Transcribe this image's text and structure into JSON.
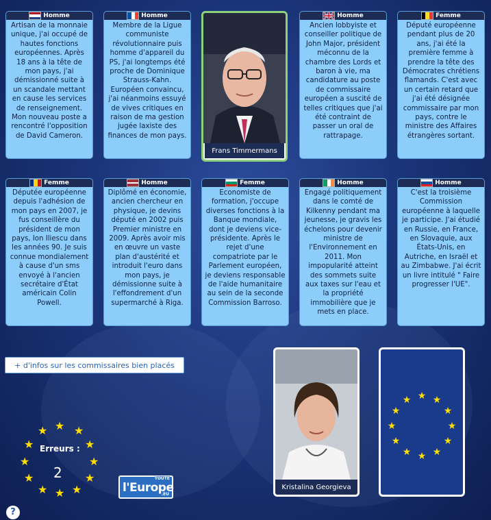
{
  "cards": [
    {
      "gender": "Homme",
      "text": "Artisan de la monnaie unique, j'ai occupé de hautes fonctions européennes. Après 18 ans à la tête de mon pays, j'ai démissionné suite à un scandale mettant en cause les services de renseignement. Mon nouveau poste a rencontré l'opposition de David Cameron."
    },
    {
      "gender": "Homme",
      "text": "Membre de la Ligue communiste révolutionnaire puis homme d'appareil du PS, j'ai longtemps été proche de Dominique Strauss-Kahn. Européen convaincu, j'ai néanmoins essuyé de vives critiques en raison de ma gestion jugée laxiste des finances de mon pays."
    },
    {
      "gender": "Homme",
      "text": "Ancien lobbyiste et conseiller politique de John Major, président méconnu de la chambre des Lords et baron à vie, ma candidature au poste de commissaire européen a suscité de telles critiques que j'ai été contraint de passer un oral de rattrapage."
    },
    {
      "gender": "Femme",
      "text": "Député européenne pendant plus de 20 ans, j'ai été la première femme à prendre la tête des Démocrates chrétiens flamands. C'est avec un certain retard que j'ai été désignée commissaire par mon pays, contre le ministre des Affaires étrangères sortant."
    },
    {
      "gender": "Femme",
      "text": "Députée européenne depuis l'adhésion de mon pays en 2007, je fus conseillère du président de mon pays, Ion Iliescu dans les années 90. Je suis connue mondialement à cause d'un sms envoyé à l'ancien secrétaire d'État américain Colin Powell."
    },
    {
      "gender": "Homme",
      "text": "Diplômé en économie, ancien chercheur en physique, je devins député en 2002 puis Premier ministre en 2009. Après avoir mis en œuvre un vaste plan d'austérité et introduit l'euro dans mon pays, je démissionne suite à l'effondrement d'un supermarché à Riga."
    },
    {
      "gender": "Femme",
      "text": "Economiste de formation, j'occupe diverses fonctions à la Banque mondiale, dont je deviens vice-présidente. Après le rejet d'une compatriote par le Parlement européen, je deviens responsable de l'aide humanitaire au sein de la seconde Commission Barroso."
    },
    {
      "gender": "Homme",
      "text": "Engagé politiquement dans le comté de Kilkenny pendant ma jeunesse, je gravis les échelons pour devenir ministre de l'Environnement en 2011. Mon impopularité atteint des sommets suite aux taxes sur l'eau et la propriété immobilière que je mets en place."
    },
    {
      "gender": "Homme",
      "text": "C'est la troisième Commission européenne à laquelle je participe. J'ai étudié en Russie, en France, en Slovaquie, aux États-Unis, en Autriche, en Israël et au Zimbabwe. J'ai écrit un livre intitulé \" Faire progresser l'UE\"."
    }
  ],
  "revealed": [
    {
      "name": "Frans Timmermans"
    },
    {
      "name": "Kristalina  Georgieva"
    }
  ],
  "info_link": "+ d'infos sur les commissaires bien placés",
  "errors": {
    "label": "Erreurs :",
    "value": "2"
  },
  "logo": {
    "top": "TOUTE",
    "main": "l'Europe",
    "suffix": ".EU"
  },
  "help": "?",
  "colors": {
    "card": "#8dcdfc",
    "header": "#1c2c55",
    "star": "#ffdd00",
    "highlight": "#8fd07a"
  }
}
